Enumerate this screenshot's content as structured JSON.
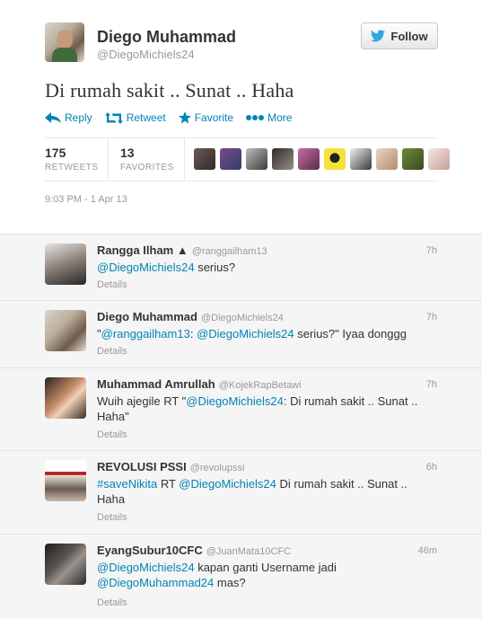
{
  "main_tweet": {
    "fullname": "Diego Muhammad",
    "username": "@DiegoMichiels24",
    "follow_label": "Follow",
    "text": "Di rumah sakit .. Sunat .. Haha",
    "actions": {
      "reply": "Reply",
      "retweet": "Retweet",
      "favorite": "Favorite",
      "more": "More"
    },
    "stats": {
      "retweets_count": "175",
      "retweets_label": "RETWEETS",
      "favorites_count": "13",
      "favorites_label": "FAVORITES"
    },
    "timestamp": "9:03 PM - 1 Apr 13"
  },
  "colors": {
    "link": "#0084b4",
    "muted": "#999999",
    "replies_bg": "#f5f5f5"
  },
  "replies": [
    {
      "name": "Rangga Ilham ▲",
      "handle": "@ranggailham13",
      "time": "7h",
      "text_parts": [
        {
          "text": "@DiegoMichiels24",
          "link": true
        },
        {
          "text": " serius?",
          "link": false
        }
      ],
      "details": "Details"
    },
    {
      "name": "Diego Muhammad",
      "handle": "@DiegoMichiels24",
      "time": "7h",
      "text_parts": [
        {
          "text": "\"",
          "link": false
        },
        {
          "text": "@ranggailham13",
          "link": true
        },
        {
          "text": ": ",
          "link": false
        },
        {
          "text": "@DiegoMichiels24",
          "link": true
        },
        {
          "text": " serius?\" Iyaa donggg",
          "link": false
        }
      ],
      "details": "Details"
    },
    {
      "name": "Muhammad Amrullah",
      "handle": "@KojekRapBetawi",
      "time": "7h",
      "text_parts": [
        {
          "text": "Wuih ajegile  RT \"",
          "link": false
        },
        {
          "text": "@DiegoMichiels24",
          "link": true
        },
        {
          "text": ": Di rumah sakit .. Sunat .. Haha\"",
          "link": false
        }
      ],
      "details": "Details"
    },
    {
      "name": "REVOLUSI PSSI",
      "handle": "@revolupssi",
      "time": "6h",
      "text_parts": [
        {
          "text": "#saveNikita",
          "link": true
        },
        {
          "text": " RT ",
          "link": false
        },
        {
          "text": "@DiegoMichiels24",
          "link": true
        },
        {
          "text": " Di rumah sakit .. Sunat .. Haha",
          "link": false
        }
      ],
      "details": "Details"
    },
    {
      "name": "EyangSubur10CFC",
      "handle": "@JuanMata10CFC",
      "time": "46m",
      "text_parts": [
        {
          "text": "@DiegoMichiels24",
          "link": true
        },
        {
          "text": " kapan ganti Username jadi ",
          "link": false
        },
        {
          "text": "@DiegoMuhammad24",
          "link": true
        },
        {
          "text": " mas?",
          "link": false
        }
      ],
      "details": "Details"
    }
  ]
}
